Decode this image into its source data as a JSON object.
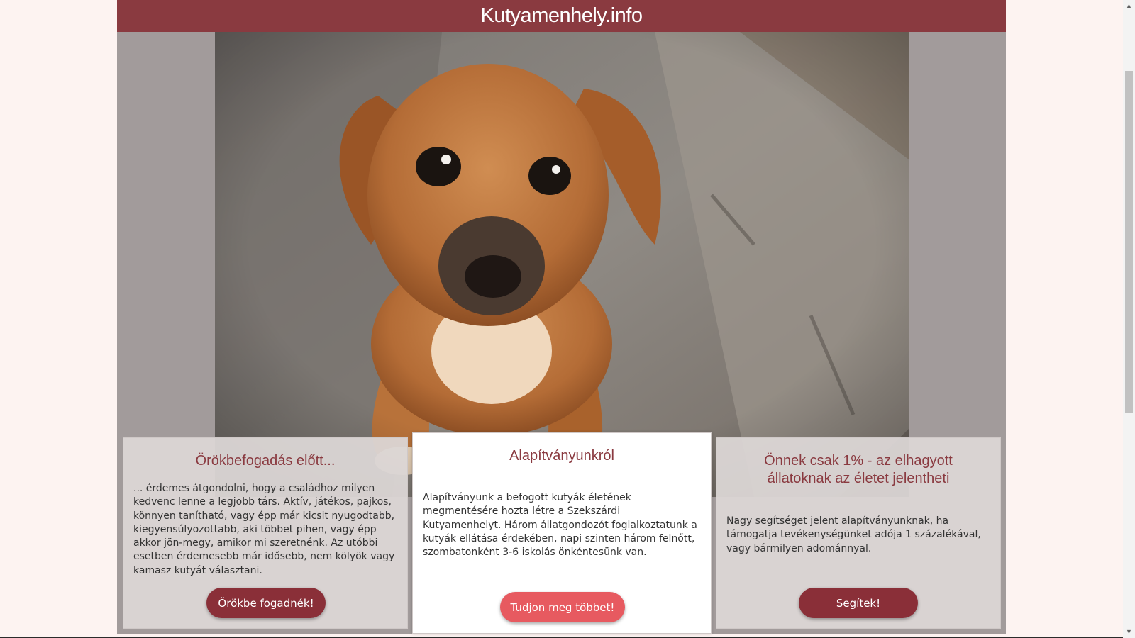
{
  "site": {
    "title": "Kutyamenhely.info"
  },
  "hero": {
    "image_alt": "Kiskutya néz felfelé"
  },
  "cards": {
    "adoption": {
      "title": "Örökbefogadás előtt...",
      "text": "... érdemes átgondolni, hogy a családhoz milyen kedvenc lenne a legjobb társ. Aktív, játékos, pajkos, könnyen tanítható, vagy épp már kicsit nyugodtabb, kiegyensúlyozottabb, aki többet pihen, vagy épp akkor jön-megy, amikor mi szeretnénk. Az utóbbi esetben érdemesebb már idősebb, nem kölyök vagy kamasz kutyát választani.",
      "button": "Örökbe fogadnék!"
    },
    "about": {
      "title": "Alapítványunkról",
      "text": "Alapítványunk a befogott kutyák életének megmentésére hozta létre a Szekszárdi Kutyamenhelyt. Három állatgondozót foglalkoztatunk a kutyák ellátása érdekében, napi szinten három felnőtt, szombatonként 3-6 iskolás önkéntesünk van.",
      "button": "Tudjon meg többet!"
    },
    "support": {
      "title": "Önnek csak 1% - az elhagyott állatoknak az életet jelentheti",
      "text": "Nagy segítséget jelent alapítványunknak, ha támogatja tevékenységünket adója 1 százalékával, vagy bármilyen adománnyal.",
      "button": "Segítek!"
    }
  },
  "colors": {
    "header": "#8a3a40",
    "accent_dark": "#8a2f38",
    "accent_light": "#e75a60",
    "page_bg": "#fdf3f1"
  },
  "icons": {
    "scroll_up": "scroll-up-arrow-icon",
    "scroll_down": "scroll-down-arrow-icon"
  }
}
